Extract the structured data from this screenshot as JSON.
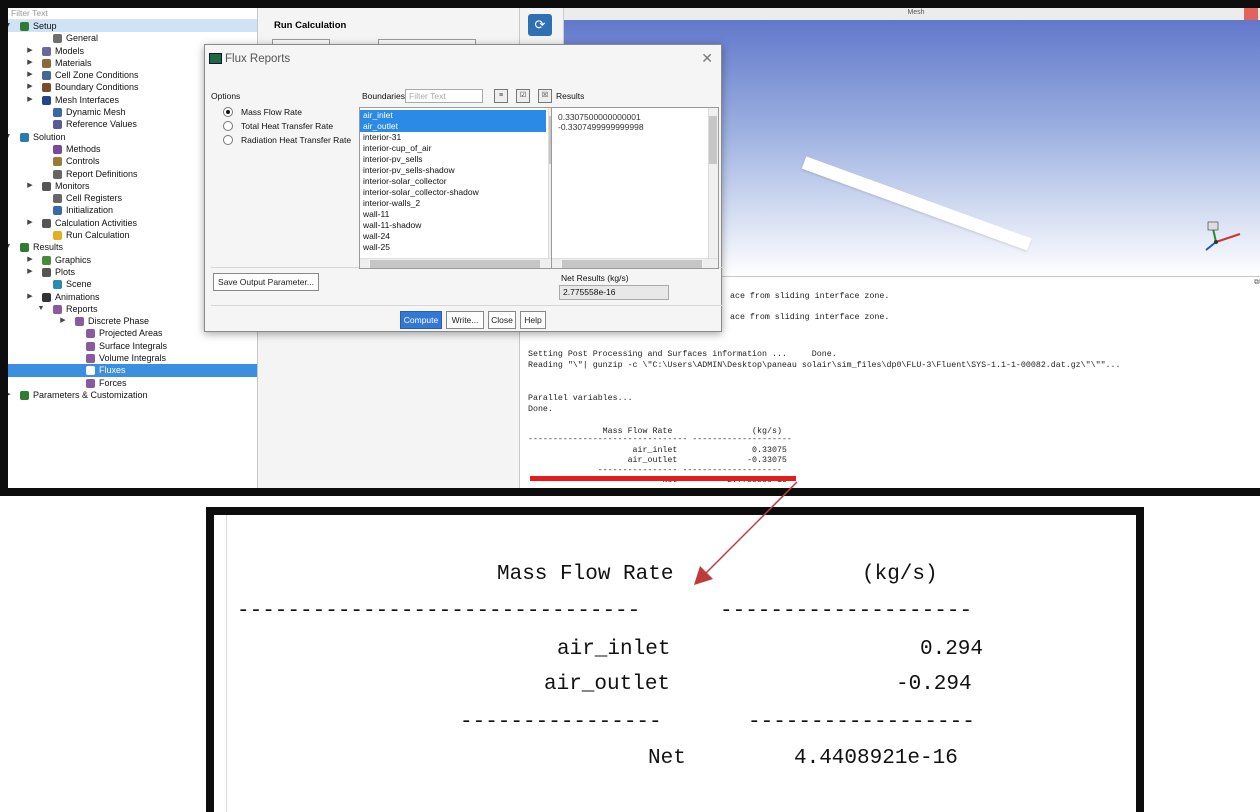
{
  "tree": {
    "filter_placeholder": "Filter Text",
    "items": [
      {
        "label": "Setup"
      },
      {
        "label": "General"
      },
      {
        "label": "Models"
      },
      {
        "label": "Materials"
      },
      {
        "label": "Cell Zone Conditions"
      },
      {
        "label": "Boundary Conditions"
      },
      {
        "label": "Mesh Interfaces"
      },
      {
        "label": "Dynamic Mesh"
      },
      {
        "label": "Reference Values"
      },
      {
        "label": "Solution"
      },
      {
        "label": "Methods"
      },
      {
        "label": "Controls"
      },
      {
        "label": "Report Definitions"
      },
      {
        "label": "Monitors"
      },
      {
        "label": "Cell Registers"
      },
      {
        "label": "Initialization"
      },
      {
        "label": "Calculation Activities"
      },
      {
        "label": "Run Calculation"
      },
      {
        "label": "Results"
      },
      {
        "label": "Graphics"
      },
      {
        "label": "Plots"
      },
      {
        "label": "Scene"
      },
      {
        "label": "Animations"
      },
      {
        "label": "Reports"
      },
      {
        "label": "Discrete Phase"
      },
      {
        "label": "Projected Areas"
      },
      {
        "label": "Surface Integrals"
      },
      {
        "label": "Volume Integrals"
      },
      {
        "label": "Fluxes"
      },
      {
        "label": "Forces"
      },
      {
        "label": "Parameters & Customization"
      }
    ]
  },
  "run_calc": {
    "title": "Run Calculation"
  },
  "graphics": {
    "window_title": "Mesh"
  },
  "dialog": {
    "title": "Flux Reports",
    "options_label": "Options",
    "options": [
      "Mass Flow Rate",
      "Total Heat Transfer Rate",
      "Radiation Heat Transfer Rate"
    ],
    "selected_option": 0,
    "boundaries_label": "Boundaries",
    "filter_placeholder": "Filter Text",
    "results_label": "Results",
    "boundaries": [
      {
        "name": "air_inlet",
        "selected": true
      },
      {
        "name": "air_outlet",
        "selected": true
      },
      {
        "name": "interior-31",
        "selected": false
      },
      {
        "name": "interior-cup_of_air",
        "selected": false
      },
      {
        "name": "interior-pv_sells",
        "selected": false
      },
      {
        "name": "interior-pv_sells-shadow",
        "selected": false
      },
      {
        "name": "interior-solar_collector",
        "selected": false
      },
      {
        "name": "interior-solar_collector-shadow",
        "selected": false
      },
      {
        "name": "interior-walls_2",
        "selected": false
      },
      {
        "name": "wall-11",
        "selected": false
      },
      {
        "name": "wall-11-shadow",
        "selected": false
      },
      {
        "name": "wall-24",
        "selected": false
      },
      {
        "name": "wall-25",
        "selected": false
      }
    ],
    "results": [
      "0.3307500000000001",
      "-0.3307499999999998"
    ],
    "save_output_label": "Save Output Parameter...",
    "net_results_label": "Net Results (kg/s)",
    "net_results_value": "2.775558e-16",
    "buttons": {
      "compute": "Compute",
      "write": "Write...",
      "close": "Close",
      "help": "Help"
    }
  },
  "console": {
    "lines": [
      "ace from sliding interface zone.",
      "ace from sliding interface zone.",
      "Setting Post Processing and Surfaces information ...     Done.",
      "Reading \"\\\"| gunzip -c \\\"C:\\Users\\ADMIN\\Desktop\\paneau solair\\sim_files\\dp0\\FLU-3\\Fluent\\SYS-1.1-1-00082.dat.gz\\\"\\\"\"...",
      "Parallel variables...",
      "Done.",
      "               Mass Flow Rate                (kg/s)",
      "-------------------------------- --------------------",
      "                     air_inlet               0.33075",
      "                    air_outlet              -0.33075",
      "              ---------------- --------------------",
      "                           Net          2.775558e-16"
    ]
  },
  "zoomed_report": {
    "header_label": "Mass Flow Rate",
    "header_unit": "(kg/s)",
    "divider_left": "--------------------------------",
    "divider_right": "--------------------",
    "rows": [
      {
        "name": "air_inlet",
        "value": "0.294"
      },
      {
        "name": "air_outlet",
        "value": "-0.294"
      }
    ],
    "subdivider_left": "----------------",
    "subdivider_right": "------------------",
    "net_label": "Net",
    "net_value": "4.4408921e-16"
  },
  "colors": {
    "highlight_line": "#e61b1b",
    "arrow": "#c0393b",
    "selection": "#2a8ae6"
  }
}
